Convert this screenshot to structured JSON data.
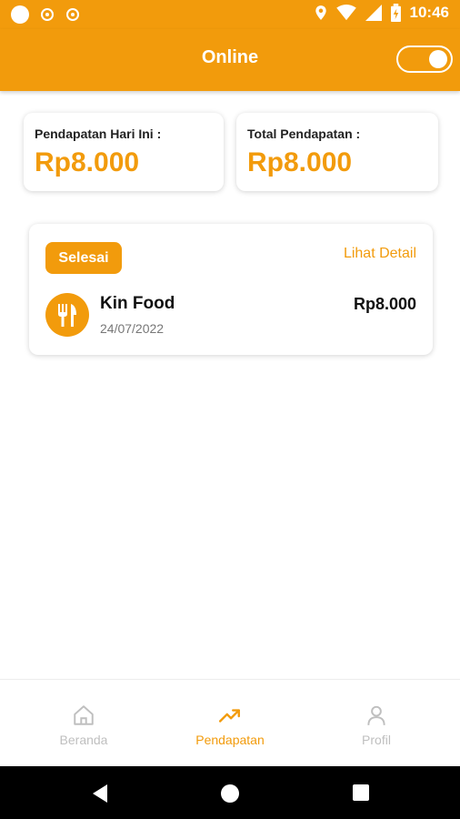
{
  "status_bar": {
    "time": "10:46",
    "icons": [
      "circle-notification-icon",
      "sync-icon",
      "sync-icon",
      "location-icon",
      "wifi-icon",
      "signal-icon",
      "battery-icon"
    ]
  },
  "app_bar": {
    "title": "Online",
    "online_toggle_on": true
  },
  "summary": {
    "today_label": "Pendapatan Hari Ini :",
    "today_value": "Rp8.000",
    "total_label": "Total Pendapatan :",
    "total_value": "Rp8.000"
  },
  "transactions": [
    {
      "status": "Selesai",
      "detail_link": "Lihat Detail",
      "name": "Kin Food",
      "date": "24/07/2022",
      "amount": "Rp8.000",
      "icon": "fork-knife-icon"
    }
  ],
  "bottom_nav": {
    "items": [
      {
        "label": "Beranda",
        "icon": "home-icon",
        "active": false
      },
      {
        "label": "Pendapatan",
        "icon": "trending-up-icon",
        "active": true
      },
      {
        "label": "Profil",
        "icon": "person-icon",
        "active": false
      }
    ]
  },
  "colors": {
    "primary": "#f29b0c",
    "inactive": "#bfbfbf"
  }
}
